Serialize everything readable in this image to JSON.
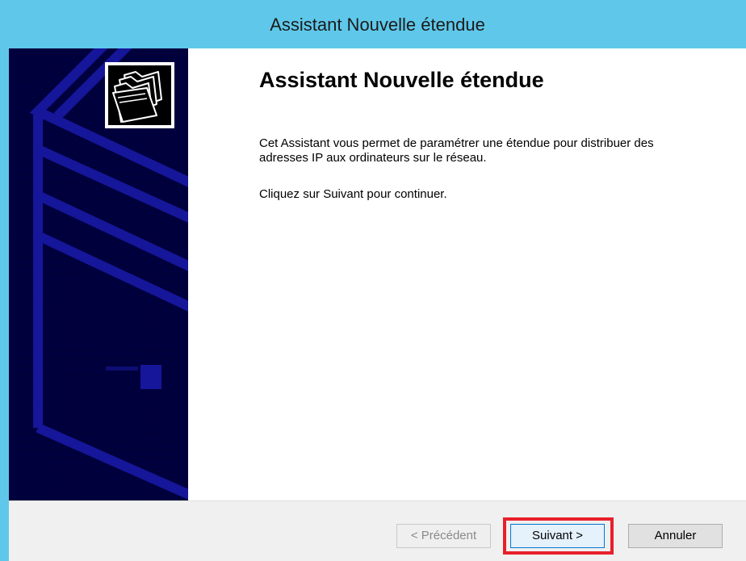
{
  "window": {
    "title": "Assistant Nouvelle étendue"
  },
  "icons": {
    "wizard": "folders-icon",
    "background": "server-tower-illustration"
  },
  "content": {
    "heading": "Assistant Nouvelle étendue",
    "description": "Cet Assistant vous permet de paramétrer une étendue pour distribuer des adresses IP aux ordinateurs sur le réseau.",
    "instruction": "Cliquez sur Suivant pour continuer."
  },
  "buttons": {
    "previous": "< Précédent",
    "next": "Suivant >",
    "cancel": "Annuler"
  },
  "colors": {
    "titlebar": "#5fc8ea",
    "panel": "#000033",
    "highlight": "#e8202a"
  }
}
